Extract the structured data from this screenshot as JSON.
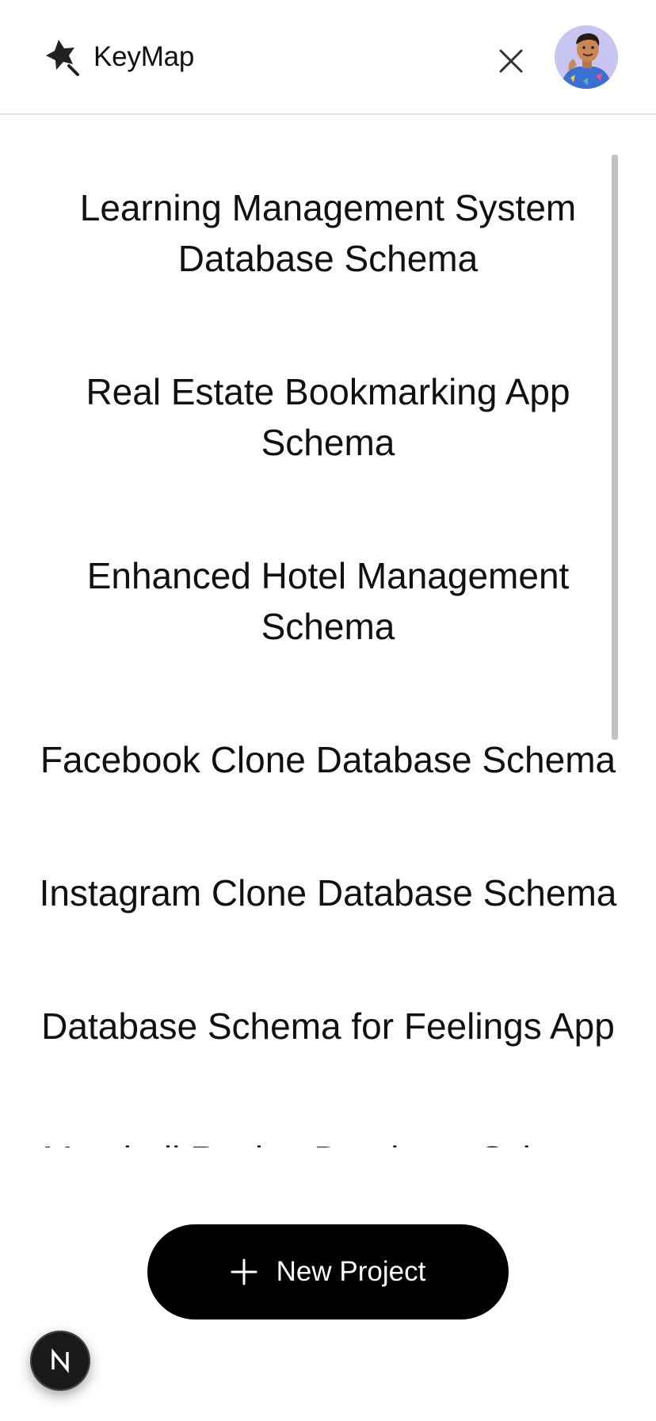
{
  "header": {
    "app_name": "KeyMap",
    "logo_icon": "star-cursor-icon",
    "close_icon": "close-icon",
    "avatar": "user-avatar"
  },
  "projects": [
    "Learning Management System Database Schema",
    "Real Estate Bookmarking App Schema",
    "Enhanced Hotel Management Schema",
    "Facebook Clone Database Schema",
    "Instagram Clone Database Schema",
    "Database Schema for Feelings App",
    "Meatball Recipe Database Schema"
  ],
  "actions": {
    "new_project_label": "New Project",
    "new_project_icon": "plus-icon"
  },
  "badge": {
    "label": "N",
    "icon": "nextjs-icon"
  },
  "colors": {
    "button_bg": "#000000",
    "button_text": "#ffffff",
    "avatar_bg": "#c9c5f2",
    "divider": "#e6e6e6",
    "scrollbar": "#c2c2c2"
  }
}
